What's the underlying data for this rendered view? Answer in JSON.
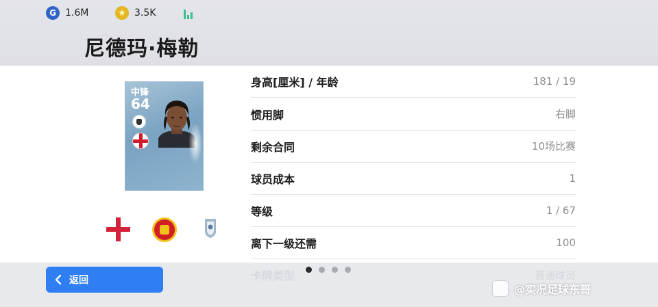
{
  "currency": {
    "gp_icon": "G",
    "gp_value": "1.6M",
    "coin_icon": "★",
    "coin_value": "3.5K"
  },
  "player": {
    "name": "尼德玛·梅勒",
    "card_position": "中锋",
    "card_rating": "64"
  },
  "stats": [
    {
      "label": "身高[厘米] / 年龄",
      "value": "181 / 19"
    },
    {
      "label": "惯用脚",
      "value": "右脚"
    },
    {
      "label": "剩余合同",
      "value": "10场比赛"
    },
    {
      "label": "球员成本",
      "value": "1"
    },
    {
      "label": "等级",
      "value": "1 / 67"
    },
    {
      "label": "离下一级还需",
      "value": "100"
    },
    {
      "label": "卡牌类型",
      "value": "普通球员"
    }
  ],
  "nav": {
    "back_label": "返回",
    "page_count": 4,
    "active_page": 1
  },
  "watermark": "@实况足球东哥"
}
